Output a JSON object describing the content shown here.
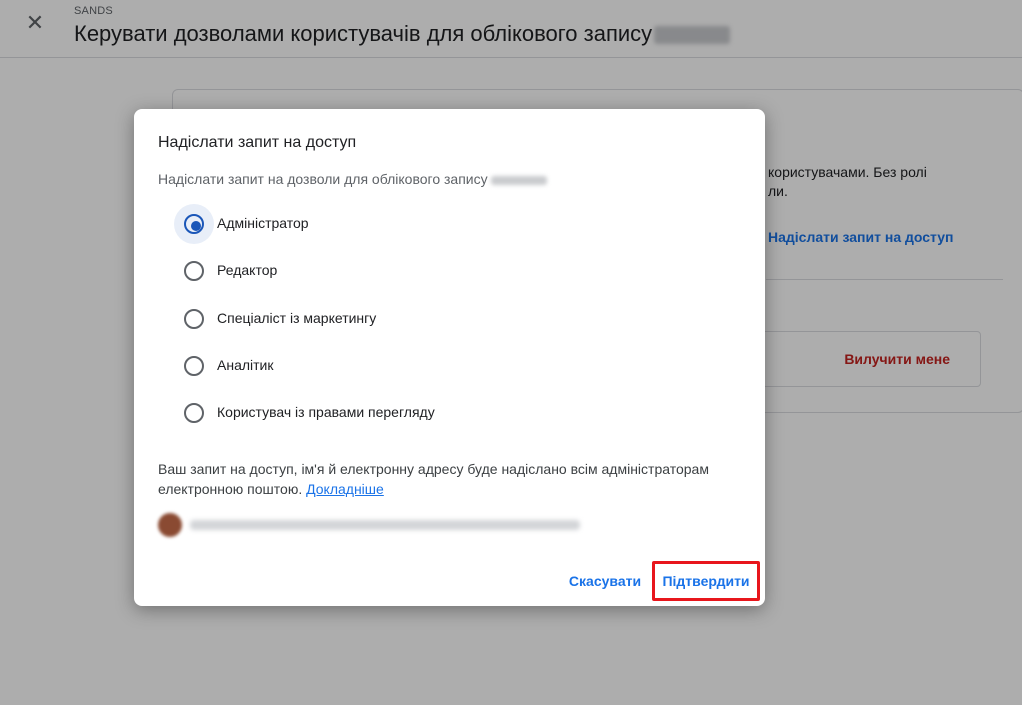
{
  "header": {
    "account_name": "SANDS",
    "title": "Керувати дозволами користувачів для облікового запису"
  },
  "background_card": {
    "description": "користувачами. Без ролі\nли.",
    "request_access_link": "Надіслати запит на доступ",
    "remove_me_label": "Вилучити мене"
  },
  "dialog": {
    "title": "Надіслати запит на доступ",
    "subtitle": "Надіслати запит на дозволи для облікового запису",
    "options": [
      {
        "label": "Адміністратор",
        "selected": true
      },
      {
        "label": "Редактор",
        "selected": false
      },
      {
        "label": "Спеціаліст із маркетингу",
        "selected": false
      },
      {
        "label": "Аналітик",
        "selected": false
      },
      {
        "label": "Користувач із правами перегляду",
        "selected": false
      }
    ],
    "info_text": "Ваш запит на доступ, ім'я й електронну адресу буде надіслано всім адміністраторам електронною поштою.",
    "learn_more_link": "Докладніше",
    "cancel_label": "Скасувати",
    "confirm_label": "Підтвердити"
  },
  "icons": {
    "close": "close-icon",
    "avatar": "avatar"
  },
  "colors": {
    "accent": "#1a73e8",
    "radio_selected": "#1a56b8",
    "danger": "#c5221f",
    "highlight_box": "#e8161c"
  }
}
